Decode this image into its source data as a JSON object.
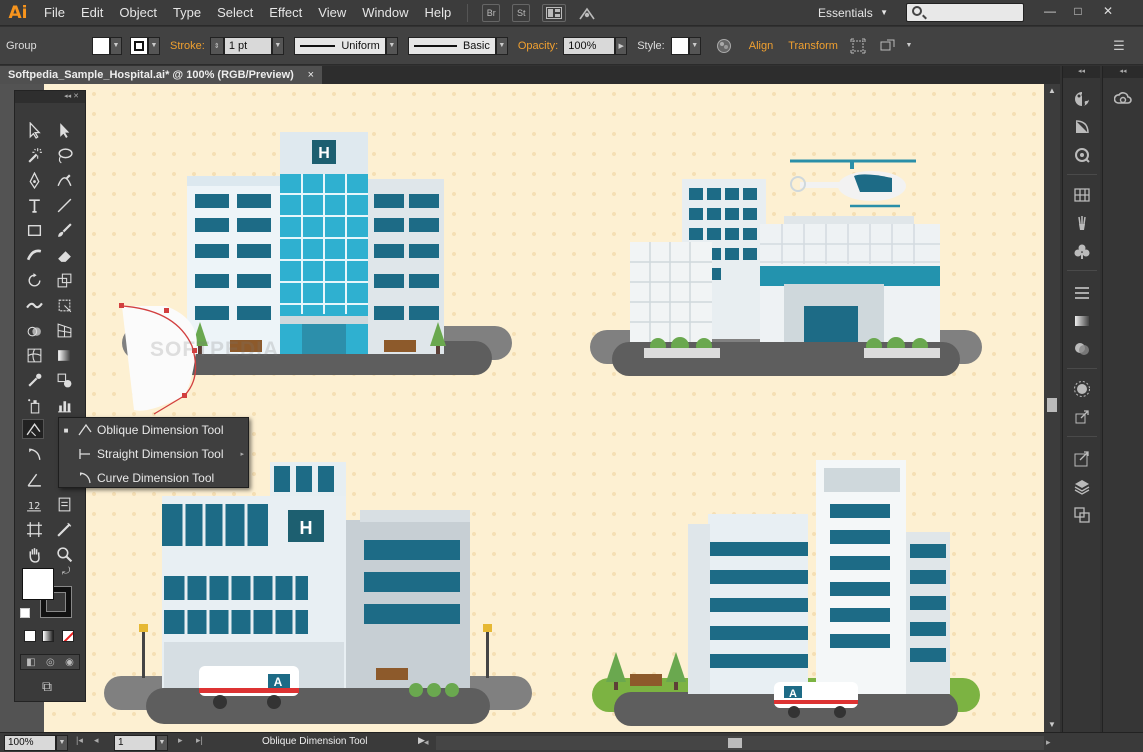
{
  "app": {
    "logo": "Ai",
    "workspace": "Essentials",
    "search_placeholder": ""
  },
  "menu": [
    "File",
    "Edit",
    "Object",
    "Type",
    "Select",
    "Effect",
    "View",
    "Window",
    "Help"
  ],
  "menubar_buttons": {
    "bridge": "Br",
    "stock": "St"
  },
  "control": {
    "selection": "Group",
    "stroke_label": "Stroke:",
    "stroke_weight": "1 pt",
    "profile": "Uniform",
    "brush": "Basic",
    "opacity_label": "Opacity:",
    "opacity_value": "100%",
    "style_label": "Style:",
    "align": "Align",
    "transform": "Transform"
  },
  "document": {
    "tab_title": "Softpedia_Sample_Hospital.ai* @ 100% (RGB/Preview)",
    "close": "×"
  },
  "flyout": {
    "items": [
      {
        "label": "Oblique Dimension Tool",
        "selected": true
      },
      {
        "label": "Straight Dimension Tool",
        "selected": false
      },
      {
        "label": "Curve Dimension Tool",
        "selected": false
      }
    ]
  },
  "artwork": {
    "hospital_sign_1": "H",
    "hospital_sign_2": "H",
    "ambulance_1": "A",
    "ambulance_2": "A"
  },
  "watermark": "SOFTPEDIA",
  "status": {
    "zoom": "100%",
    "artboard": "1",
    "tool": "Oblique Dimension Tool"
  },
  "colors": {
    "accent_orange": "#f7941d",
    "artboard_bg": "#fdf0d2",
    "teal_glass": "#1d6b86",
    "cyan_glass": "#2fb0d0"
  }
}
